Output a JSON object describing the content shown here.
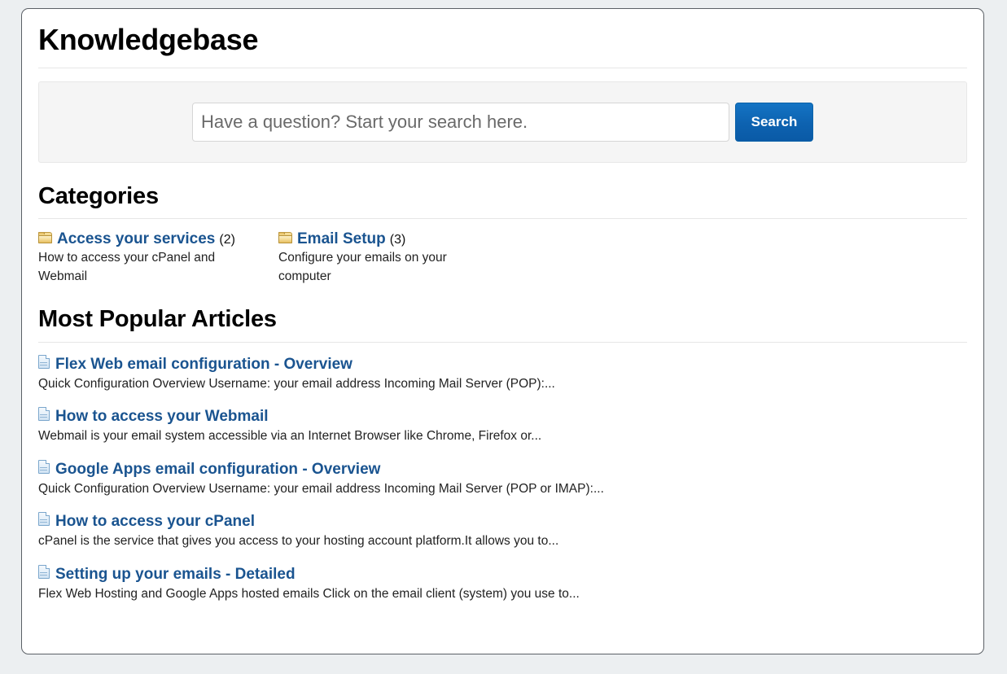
{
  "page": {
    "title": "Knowledgebase"
  },
  "search": {
    "placeholder": "Have a question? Start your search here.",
    "value": "",
    "button_label": "Search",
    "input_icon": "search-input",
    "accent_color": "#0d62b0"
  },
  "categories_section": {
    "heading": "Categories",
    "items": [
      {
        "icon": "folder-icon",
        "name": "Access your services",
        "count": "(2)",
        "description": "How to access your cPanel and Webmail"
      },
      {
        "icon": "folder-icon",
        "name": "Email Setup",
        "count": "(3)",
        "description": "Configure your emails on your computer"
      }
    ]
  },
  "articles_section": {
    "heading": "Most Popular Articles",
    "items": [
      {
        "icon": "document-icon",
        "title": "Flex Web email configuration - Overview",
        "excerpt": "Quick Configuration Overview Username: your email address Incoming Mail Server (POP):..."
      },
      {
        "icon": "document-icon",
        "title": "How to access your Webmail",
        "excerpt": "Webmail is your email system accessible via an Internet Browser like Chrome, Firefox or..."
      },
      {
        "icon": "document-icon",
        "title": "Google Apps email configuration - Overview",
        "excerpt": "Quick Configuration Overview Username: your email address Incoming Mail Server (POP or IMAP):..."
      },
      {
        "icon": "document-icon",
        "title": "How to access your cPanel",
        "excerpt": "cPanel is the service that gives you access to your hosting account platform.It allows you to..."
      },
      {
        "icon": "document-icon",
        "title": "Setting up your emails - Detailed",
        "excerpt": "Flex Web Hosting and Google Apps hosted emails Click on the email client (system) you use to..."
      }
    ]
  },
  "colors": {
    "link": "#1a5490",
    "page_background": "#eceff1",
    "panel_background": "#ffffff",
    "search_panel_background": "#f5f5f5"
  }
}
